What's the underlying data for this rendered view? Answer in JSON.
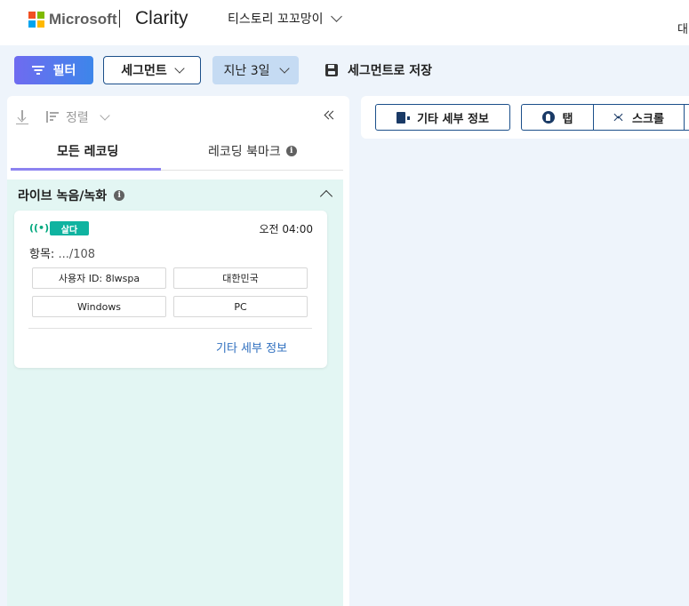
{
  "header": {
    "brand_microsoft": "Microsoft",
    "brand_product": "Clarity",
    "project_name": "티스토리 꼬꼬망이",
    "right_cut_text": "대",
    "logo_colors": [
      "#f25022",
      "#7fba00",
      "#00a4ef",
      "#ffb900"
    ]
  },
  "toolbar": {
    "filter_label": "필터",
    "segment_label": "세그먼트",
    "date_label": "지난 3일",
    "save_segment_label": "세그먼트로 저장"
  },
  "left_panel": {
    "sort_label": "정렬",
    "tabs": [
      {
        "label": "모든 레코딩",
        "active": true
      },
      {
        "label": "레코딩 북마크",
        "active": false
      }
    ],
    "info_glyph": "i",
    "live_section": {
      "title": "라이브 녹음/녹화",
      "card": {
        "live_icon": "((•))",
        "badge": "살다",
        "time": "오전 04:00",
        "items_label": "항목:",
        "items_value": ".../108",
        "chips": [
          "사용자 ID: 8lwspa",
          "대한민국",
          "Windows",
          "PC"
        ],
        "more_link": "기타 세부 정보"
      }
    }
  },
  "right_panel": {
    "more_details_label": "기타 세부 정보",
    "tap_label": "탭",
    "scroll_label": "스크롤"
  },
  "colors": {
    "accent_gradient_start": "#6f6bf0",
    "accent_gradient_end": "#3d86ea",
    "live_badge": "#0fb3a0",
    "live_section_bg": "#e3f6f3",
    "link": "#2f6fbf"
  }
}
